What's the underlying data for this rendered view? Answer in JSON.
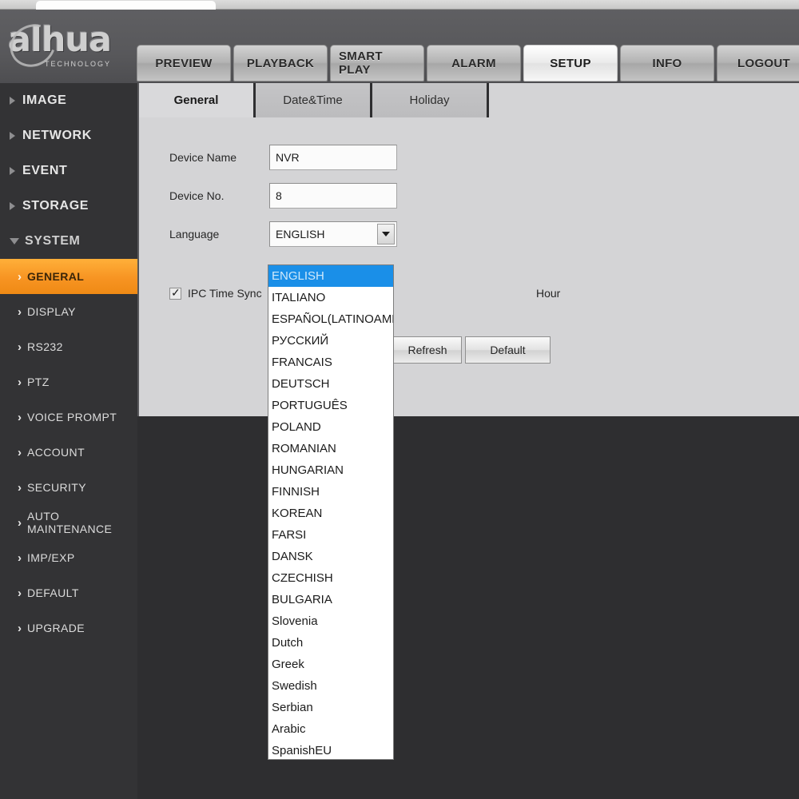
{
  "brand": {
    "name": "alhua",
    "tagline": "TECHNOLOGY"
  },
  "nav": {
    "tabs": [
      {
        "label": "PREVIEW",
        "active": false
      },
      {
        "label": "PLAYBACK",
        "active": false
      },
      {
        "label": "SMART PLAY",
        "active": false
      },
      {
        "label": "ALARM",
        "active": false
      },
      {
        "label": "SETUP",
        "active": true
      },
      {
        "label": "INFO",
        "active": false
      },
      {
        "label": "LOGOUT",
        "active": false
      }
    ]
  },
  "sidebar": {
    "groups": [
      {
        "label": "IMAGE",
        "open": false
      },
      {
        "label": "NETWORK",
        "open": false
      },
      {
        "label": "EVENT",
        "open": false
      },
      {
        "label": "STORAGE",
        "open": false
      },
      {
        "label": "SYSTEM",
        "open": true
      }
    ],
    "items": [
      {
        "label": "GENERAL",
        "selected": true
      },
      {
        "label": "DISPLAY",
        "selected": false
      },
      {
        "label": "RS232",
        "selected": false
      },
      {
        "label": "PTZ",
        "selected": false
      },
      {
        "label": "VOICE PROMPT",
        "selected": false
      },
      {
        "label": "ACCOUNT",
        "selected": false
      },
      {
        "label": "SECURITY",
        "selected": false
      },
      {
        "label": "AUTO MAINTENANCE",
        "selected": false
      },
      {
        "label": "IMP/EXP",
        "selected": false
      },
      {
        "label": "DEFAULT",
        "selected": false
      },
      {
        "label": "UPGRADE",
        "selected": false
      }
    ]
  },
  "subtabs": [
    {
      "label": "General",
      "active": true
    },
    {
      "label": "Date&Time",
      "active": false
    },
    {
      "label": "Holiday",
      "active": false
    }
  ],
  "form": {
    "device_name_label": "Device Name",
    "device_name_value": "NVR",
    "device_no_label": "Device No.",
    "device_no_value": "8",
    "language_label": "Language",
    "language_value": "ENGLISH",
    "ipc_time_sync_label": "IPC Time Sync",
    "ipc_time_sync_checked": true,
    "hour_label": "Hour",
    "refresh_label": "Refresh",
    "default_label": "Default"
  },
  "language_dropdown": {
    "selected": "ENGLISH",
    "options": [
      "ENGLISH",
      "ITALIANO",
      "ESPAÑOL(LATINOAMÉRICA)",
      "РУССКИЙ",
      "FRANCAIS",
      "DEUTSCH",
      "PORTUGUÊS",
      "POLAND",
      "ROMANIAN",
      "HUNGARIAN",
      "FINNISH",
      "KOREAN",
      "FARSI",
      "DANSK",
      "CZECHISH",
      "BULGARIA",
      "Slovenia",
      "Dutch",
      "Greek",
      "Swedish",
      "Serbian",
      "Arabic",
      "SpanishEU"
    ]
  },
  "colors": {
    "header_gray": "#58585b",
    "sidebar_dark": "#333335",
    "panel_gray": "#d4d4d6",
    "accent_orange": "#f79422",
    "highlight_blue": "#1a8fe8"
  }
}
